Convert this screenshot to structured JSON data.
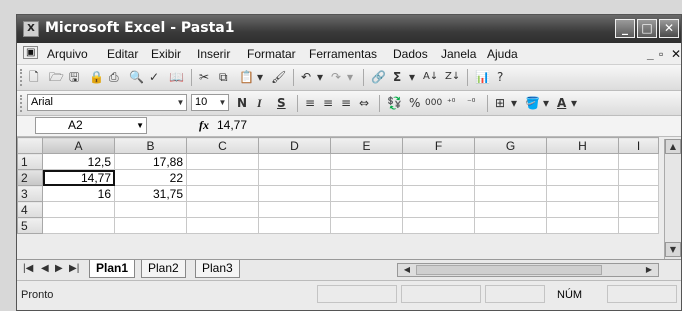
{
  "window": {
    "title": "Microsoft Excel - Pasta1"
  },
  "menu": {
    "items": [
      "Arquivo",
      "Editar",
      "Exibir",
      "Inserir",
      "Formatar",
      "Ferramentas",
      "Dados",
      "Janela",
      "Ajuda"
    ]
  },
  "toolbar": {
    "font_name": "Arial",
    "font_size": "10",
    "bold": "N",
    "italic": "I",
    "underline": "S",
    "percent": "%",
    "thousands": "000"
  },
  "formula_bar": {
    "name_box": "A2",
    "fx": "fx",
    "value": "14,77"
  },
  "grid": {
    "columns": [
      "A",
      "B",
      "C",
      "D",
      "E",
      "F",
      "G",
      "H",
      "I"
    ],
    "rows": [
      {
        "num": "1",
        "cells": [
          "12,5",
          "17,88"
        ]
      },
      {
        "num": "2",
        "cells": [
          "14,77",
          "22"
        ]
      },
      {
        "num": "3",
        "cells": [
          "16",
          "31,75"
        ]
      },
      {
        "num": "4",
        "cells": [
          "",
          ""
        ]
      },
      {
        "num": "5",
        "cells": [
          "",
          ""
        ]
      }
    ],
    "selected_cell": "A2"
  },
  "sheets": [
    "Plan1",
    "Plan2",
    "Plan3"
  ],
  "active_sheet": "Plan1",
  "status": {
    "text": "Pronto",
    "num_lock": "NÚM"
  }
}
